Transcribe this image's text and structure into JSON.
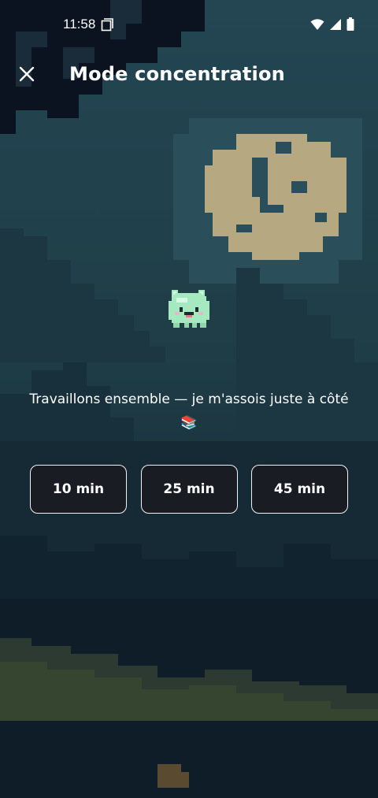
{
  "status_bar": {
    "time": "11:58",
    "icons": [
      "screenshot-doc-icon",
      "wifi-icon",
      "cell-signal-icon",
      "battery-icon"
    ]
  },
  "header": {
    "close_icon": "close-icon",
    "title": "Mode concentration"
  },
  "main": {
    "mascot": "pixel-pet-mascot",
    "message": "Travaillons ensemble — je m'assois juste à côté 📚",
    "durations": [
      {
        "label": "10 min"
      },
      {
        "label": "25 min"
      },
      {
        "label": "45 min"
      }
    ]
  },
  "colors": {
    "sky": "#1e3a44",
    "moon": "#b6a880",
    "button_bg": "#1a1b22",
    "button_border": "#f2f2f2",
    "mascot": "#a6e8c0"
  }
}
